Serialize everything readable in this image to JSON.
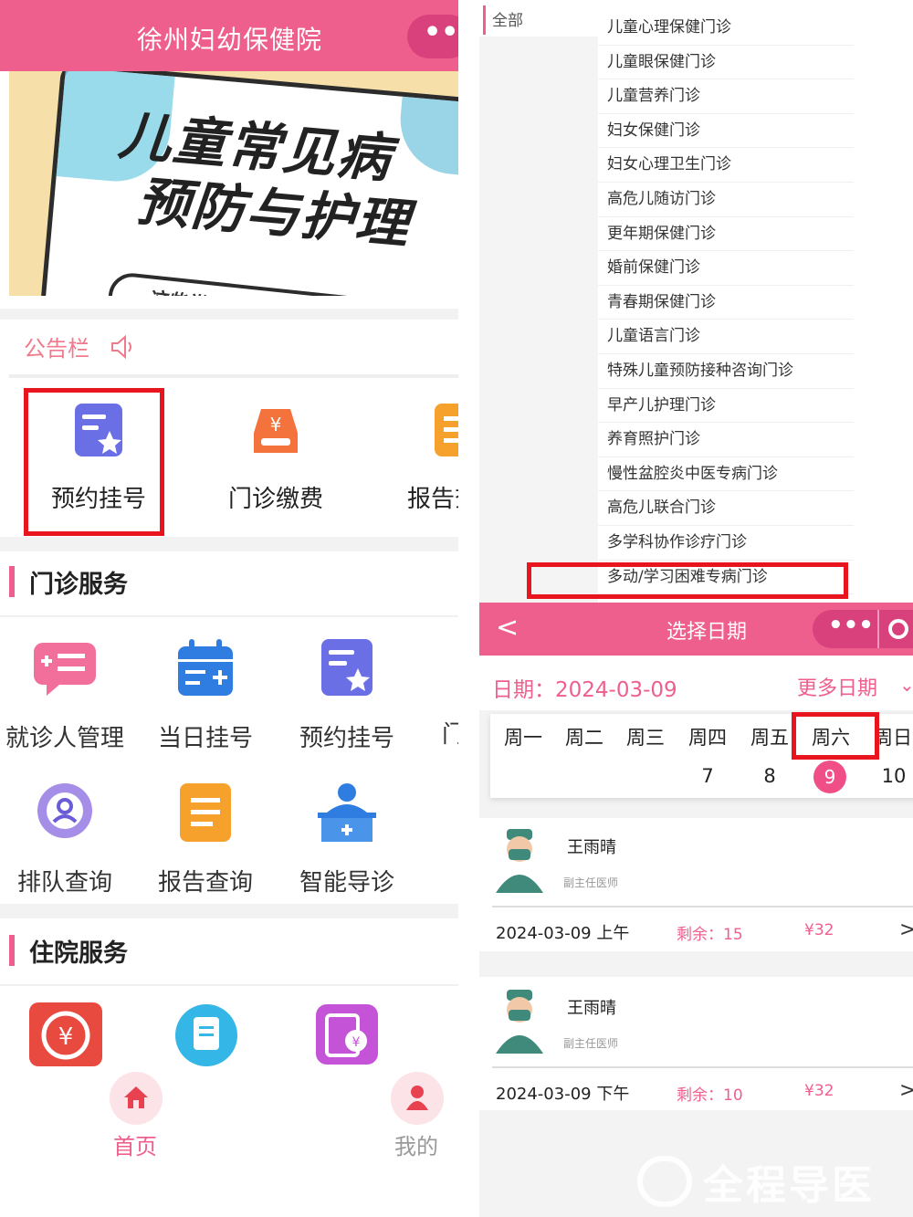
{
  "left": {
    "header": {
      "title": "徐州妇幼保健院",
      "menu_dots": "•••"
    },
    "banner": {
      "line1": "儿童常见病",
      "line2": "预防与护理",
      "sub": "这些常见问题危害您是否知道?"
    },
    "notice": {
      "title": "公告栏"
    },
    "quick_actions": [
      {
        "label": "预约挂号",
        "icon": "booking-star-icon",
        "color": "#6a6fe6"
      },
      {
        "label": "门诊缴费",
        "icon": "payment-tray-icon",
        "color": "#f4733c"
      },
      {
        "label": "报告查询",
        "icon": "report-icon",
        "color": "#f7a12d"
      }
    ],
    "outpatient": {
      "title": "门诊服务",
      "items": [
        {
          "label": "就诊人管理",
          "icon": "patient-manage-icon"
        },
        {
          "label": "当日挂号",
          "icon": "calendar-plus-icon"
        },
        {
          "label": "预约挂号",
          "icon": "booking-star-icon"
        },
        {
          "label": "门",
          "icon": "more-service-icon"
        },
        {
          "label": "排队查询",
          "icon": "queue-search-icon"
        },
        {
          "label": "报告查询",
          "icon": "report-icon"
        },
        {
          "label": "智能导诊",
          "icon": "smart-guide-icon"
        }
      ]
    },
    "inpatient": {
      "title": "住院服务"
    },
    "tabbar": {
      "home": "首页",
      "mine": "我的"
    }
  },
  "right": {
    "category_all": "全部",
    "departments": [
      "儿童心理保健门诊",
      "儿童眼保健门诊",
      "儿童营养门诊",
      "妇女保健门诊",
      "妇女心理卫生门诊",
      "高危儿随访门诊",
      "更年期保健门诊",
      "婚前保健门诊",
      "青春期保健门诊",
      "儿童语言门诊",
      "特殊儿童预防接种咨询门诊",
      "早产儿护理门诊",
      "养育照护门诊",
      "慢性盆腔炎中医专病门诊",
      "高危儿联合门诊",
      "多学科协作诊疗门诊",
      "多动/学习困难专病门诊"
    ],
    "date_page": {
      "back": "<",
      "title": "选择日期",
      "menu_dots": "•••",
      "date_label": "日期：2024-03-09",
      "more_dates": "更多日期",
      "weekdays": [
        "周一",
        "周二",
        "周三",
        "周四",
        "周五",
        "周六",
        "周日"
      ],
      "day_numbers": [
        "7",
        "8",
        "9",
        "10"
      ],
      "selected_day": "9"
    },
    "doctors": [
      {
        "name": "王雨晴",
        "title": "副主任医师",
        "slot": "2024-03-09 上午",
        "remain": "剩余：15",
        "price": "¥32",
        "chev": ">"
      },
      {
        "name": "王雨晴",
        "title": "副主任医师",
        "slot": "2024-03-09 下午",
        "remain": "剩余：10",
        "price": "¥32",
        "chev": ">"
      }
    ]
  },
  "watermark": "全程导医网",
  "accent_color": "#ef5f8d",
  "highlight_color": "#e8141e"
}
